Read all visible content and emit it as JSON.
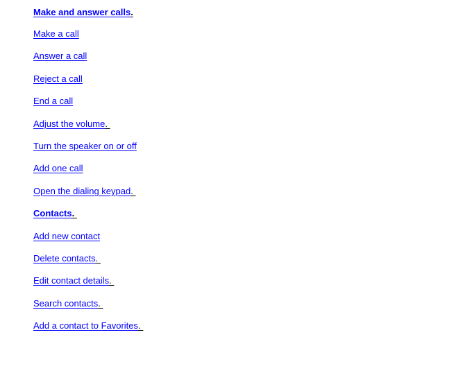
{
  "document": {
    "title": "Make and answer calls.",
    "background_color": "#ffffff",
    "link_color": "#0000ff",
    "tail_color": "#000000"
  },
  "toc": {
    "items": [
      {
        "label": "Make and answer calls",
        "tail": ".",
        "bold": true,
        "name": "link-make-and-answer-calls"
      },
      {
        "label": "Make a call",
        "tail": "",
        "bold": false,
        "name": "link-make-a-call"
      },
      {
        "label": "Answer a call",
        "tail": "",
        "bold": false,
        "name": "link-answer-a-call"
      },
      {
        "label": "Reject a call",
        "tail": "",
        "bold": false,
        "name": "link-reject-a-call"
      },
      {
        "label": "End a call",
        "tail": "",
        "bold": false,
        "name": "link-end-a-call"
      },
      {
        "label": "Adjust the volume",
        "tail": ". ",
        "bold": false,
        "name": "link-adjust-the-volume"
      },
      {
        "label": "Turn the speaker on or off",
        "tail": "",
        "bold": false,
        "name": "link-turn-the-speaker-on-or-off"
      },
      {
        "label": "Add one call",
        "tail": "",
        "bold": false,
        "name": "link-add-one-call"
      },
      {
        "label": "Open the dialing keypad",
        "tail": ". ",
        "bold": false,
        "name": "link-open-the-dialing-keypad"
      },
      {
        "label": "Contacts",
        "tail": ". ",
        "bold": true,
        "name": "link-contacts"
      },
      {
        "label": "Add new contact",
        "tail": "",
        "bold": false,
        "name": "link-add-new-contact"
      },
      {
        "label": "Delete contacts",
        "tail": ". ",
        "bold": false,
        "name": "link-delete-contacts"
      },
      {
        "label": "Edit contact details",
        "tail": ". ",
        "bold": false,
        "name": "link-edit-contact-details"
      },
      {
        "label": "Search contacts",
        "tail": ". ",
        "bold": false,
        "name": "link-search-contacts"
      },
      {
        "label": "Add a contact to Favorites",
        "tail": ". ",
        "bold": false,
        "name": "link-add-a-contact-to-favorites"
      }
    ]
  }
}
